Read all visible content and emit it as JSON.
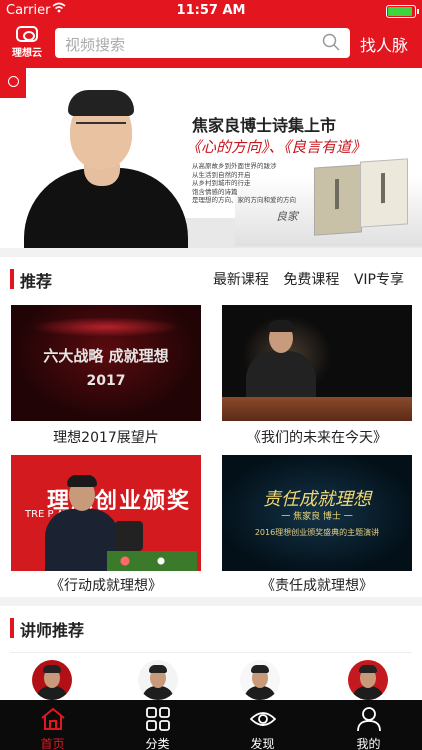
{
  "status_bar": {
    "carrier": "Carrier",
    "time": "11:57 AM"
  },
  "header": {
    "logo_text": "理想云",
    "search_placeholder": "视频搜索",
    "find_contacts": "找人脉"
  },
  "banner": {
    "title": "焦家良博士诗集上市",
    "subtitle": "《心的方向》、《良言有道》",
    "lines": [
      "从高原故乡到外面世界的跋涉",
      "从生活到自然的开启",
      "从乡村到城市的行走",
      "饱含情感的诗篇",
      "是理想的方向、家的方向和爱的方向"
    ],
    "signature": "良家"
  },
  "recommend": {
    "title": "推荐",
    "tabs": [
      "最新课程",
      "免费课程",
      "VIP专享"
    ],
    "videos": [
      {
        "caption": "理想2017展望片",
        "thumb_text": "六大战略 成就理想",
        "thumb_year": "2017"
      },
      {
        "caption": "《我们的未来在今天》"
      },
      {
        "caption": "《行动成就理想》",
        "thumb_text": "理想创业颁奖",
        "thumb_sub": "TRE    P AWARD"
      },
      {
        "caption": "《责任成就理想》",
        "thumb_text": "责任成就理想",
        "thumb_sub": "一  焦家良  博士  一",
        "thumb_line": "2016理想创业颁奖盛典的主题演讲"
      }
    ]
  },
  "lecturers": {
    "title": "讲师推荐"
  },
  "tabbar": {
    "items": [
      {
        "label": "首页",
        "icon": "home-icon",
        "active": true
      },
      {
        "label": "分类",
        "icon": "grid-icon"
      },
      {
        "label": "发现",
        "icon": "eye-icon"
      },
      {
        "label": "我的",
        "icon": "user-icon"
      }
    ]
  },
  "colors": {
    "accent": "#e3161f",
    "tabbar_bg": "#0b0b0b"
  }
}
